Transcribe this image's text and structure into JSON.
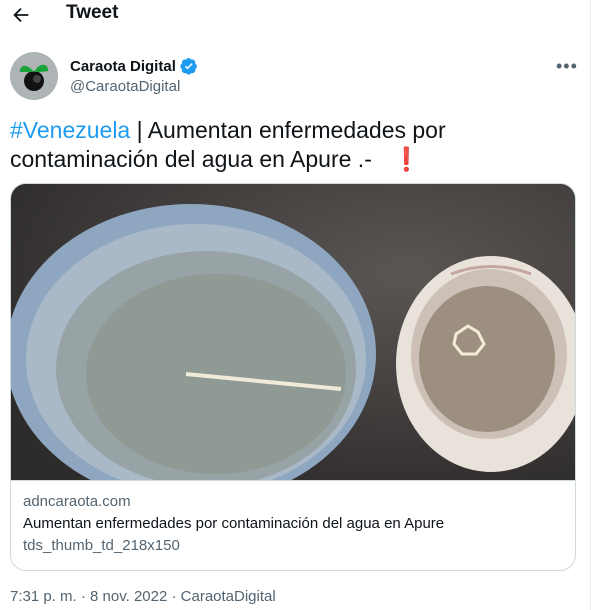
{
  "header": {
    "title": "Tweet"
  },
  "author": {
    "name": "Caraota Digital",
    "handle": "@CaraotaDigital",
    "verified": true
  },
  "tweet": {
    "hashtag": "#Venezuela",
    "text": " | Aumentan enfermedades por contaminación del agua en Apure .- ",
    "emoji": "❗"
  },
  "card": {
    "domain": "adncaraota.com",
    "title": "Aumentan enfermedades por contaminación del agua en Apure",
    "description": "tds_thumb_td_218x150"
  },
  "timestamp": "7:31 p. m. · 8 nov. 2022 · CaraotaDigital",
  "icons": {
    "back": "arrow-left-icon",
    "verified": "verified-badge-icon",
    "more": "more-horizontal-icon"
  },
  "colors": {
    "link": "#1d9bf0",
    "verified": "#1d9bf0",
    "secondary": "#536471",
    "border": "#cfd9de"
  }
}
